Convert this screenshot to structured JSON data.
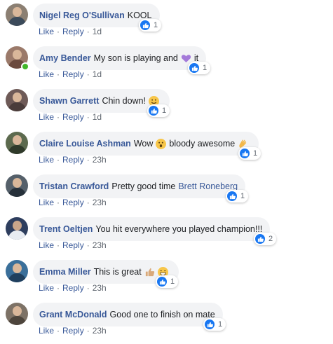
{
  "comments": [
    {
      "name": "Nigel Reg O'Sullivan",
      "text_before": "KOOL",
      "emoji": "",
      "text_after": "",
      "tag": "",
      "like": "Like",
      "reply": "Reply",
      "time": "1d",
      "reactions": "1",
      "online": false,
      "avatar_color": "#8b7f72"
    },
    {
      "name": "Amy Bender",
      "text_before": "My son is playing and",
      "emoji": "purple-heart",
      "text_after": "it",
      "tag": "",
      "like": "Like",
      "reply": "Reply",
      "time": "1d",
      "reactions": "1",
      "online": true,
      "avatar_color": "#9b7a6a"
    },
    {
      "name": "Shawn Garrett",
      "text_before": "Chin down!",
      "emoji": "smiley",
      "text_after": "",
      "tag": "",
      "like": "Like",
      "reply": "Reply",
      "time": "1d",
      "reactions": "1",
      "online": false,
      "avatar_color": "#6e5a57"
    },
    {
      "name": "Claire Louise Ashman",
      "text_before": "Wow",
      "emoji": "astonished",
      "text_after": "bloody awesome",
      "emoji2": "clap",
      "tag": "",
      "like": "Like",
      "reply": "Reply",
      "time": "23h",
      "reactions": "1",
      "online": false,
      "avatar_color": "#5c6a4e"
    },
    {
      "name": "Tristan Crawford",
      "text_before": "Pretty good time",
      "emoji": "",
      "text_after": "",
      "tag": "Brett Roneberg",
      "like": "Like",
      "reply": "Reply",
      "time": "23h",
      "reactions": "1",
      "online": false,
      "avatar_color": "#55606a"
    },
    {
      "name": "Trent Oeltjen",
      "text_before": "You hit everywhere you played champion!!!",
      "emoji": "",
      "text_after": "",
      "tag": "",
      "like": "Like",
      "reply": "Reply",
      "time": "23h",
      "reactions": "2",
      "online": false,
      "avatar_color": "#2e3e5e"
    },
    {
      "name": "Emma Miller",
      "text_before": "This is great",
      "emoji": "thumbs-up",
      "text_after": "",
      "emoji2": "grin",
      "tag": "",
      "like": "Like",
      "reply": "Reply",
      "time": "23h",
      "reactions": "1",
      "online": false,
      "avatar_color": "#3a6f9a"
    },
    {
      "name": "Grant McDonald",
      "text_before": "Good one to finish on mate",
      "emoji": "",
      "text_after": "",
      "tag": "",
      "like": "Like",
      "reply": "Reply",
      "time": "23h",
      "reactions": "1",
      "online": false,
      "avatar_color": "#7d7266"
    }
  ],
  "colors": {
    "name": "#385898",
    "bubble": "#f2f3f5",
    "like_blue": "#1877f2"
  }
}
